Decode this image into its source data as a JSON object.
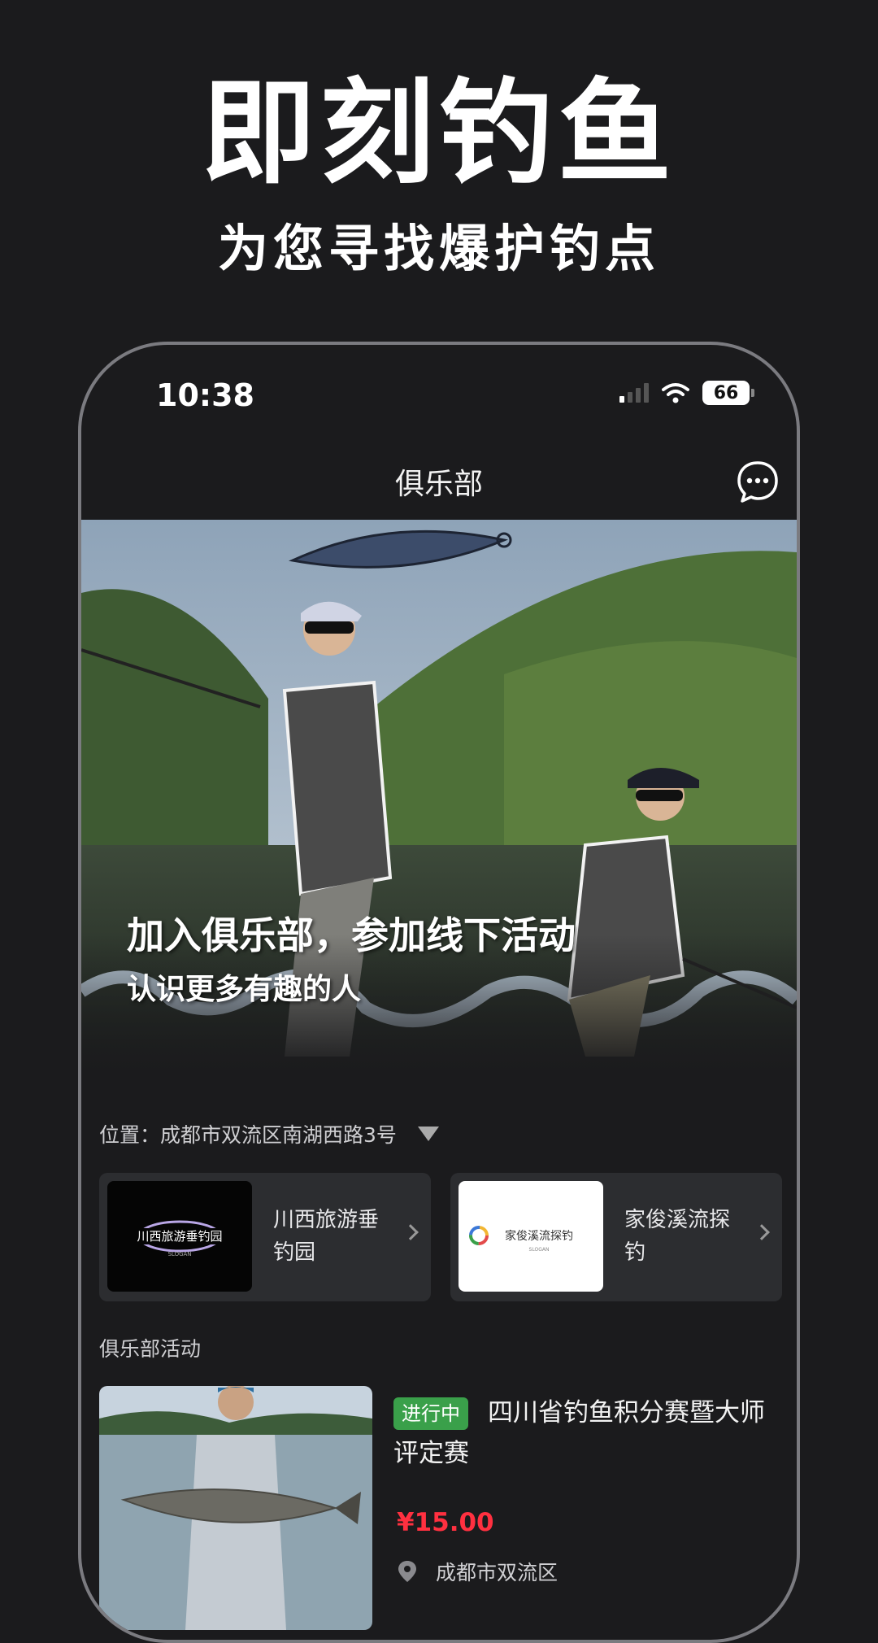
{
  "promo": {
    "title": "即刻钓鱼",
    "subtitle": "为您寻找爆护钓点"
  },
  "status_bar": {
    "time": "10:38",
    "battery": "66"
  },
  "nav": {
    "title": "俱乐部"
  },
  "hero": {
    "line1": "加入俱乐部，参加线下活动",
    "line2": "认识更多有趣的人"
  },
  "location": {
    "label": "位置：成都市双流区南湖西路3号"
  },
  "clubs": [
    {
      "name": "川西旅游垂钓园",
      "logo_text": "川西旅游垂钓园",
      "logo_slogan": "SLOGAN"
    },
    {
      "name": "家俊溪流探钓",
      "logo_text": "家俊溪流探钓",
      "logo_slogan": "SLOGAN"
    }
  ],
  "activities_section": {
    "title": "俱乐部活动"
  },
  "activity": {
    "status": "进行中",
    "title": "四川省钓鱼积分赛暨大师评定赛",
    "price": "¥15.00",
    "location": "成都市双流区"
  },
  "colors": {
    "background": "#1b1b1d",
    "card": "#2c2d30",
    "status_green": "#3aa04a",
    "price_red": "#ff3040"
  }
}
